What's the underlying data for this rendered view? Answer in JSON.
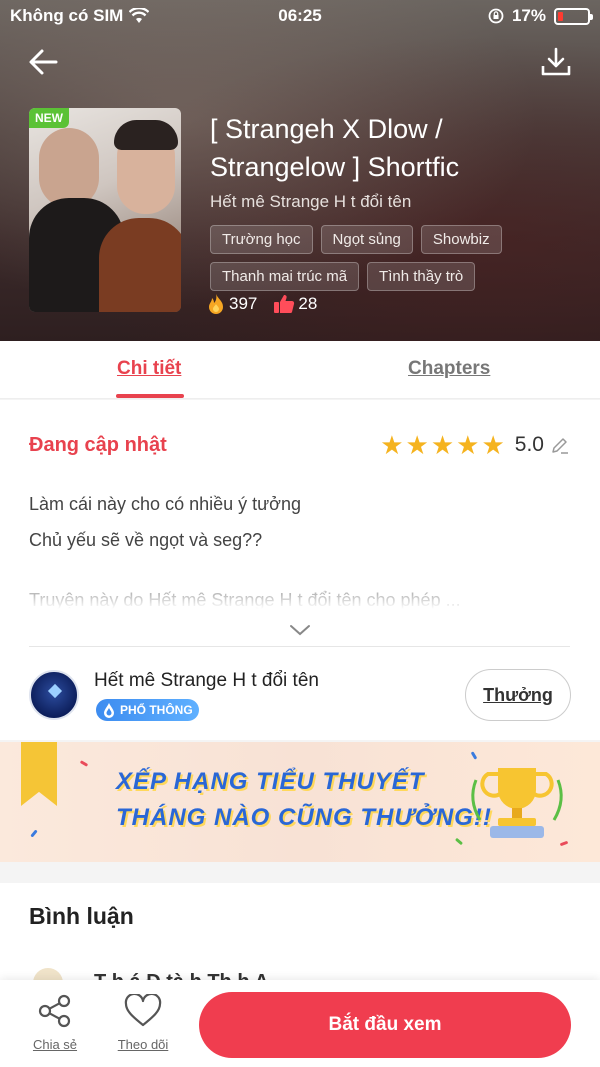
{
  "status_bar": {
    "carrier": "Không có SIM",
    "time": "06:25",
    "battery": "17%"
  },
  "book": {
    "badge": "NEW",
    "title": "[ Strangeh X Dlow / Strangelow ] Shortfic",
    "author": "Hết mê Strange H t đổi tên",
    "tags": [
      "Trường học",
      "Ngọt sủng",
      "Showbiz",
      "Thanh mai trúc mã",
      "Tình thầy trò"
    ],
    "fire_count": "397",
    "like_count": "28"
  },
  "tabs": {
    "detail": "Chi tiết",
    "chapters": "Chapters"
  },
  "detail": {
    "status": "Đang cập nhật",
    "rating": "5.0",
    "stars": 5,
    "description_lines": [
      "Làm cái này cho có nhiều ý tưởng",
      "Chủ yếu sẽ về ngọt và seg??"
    ],
    "faded_line": "Truyện này do Hết mê Strange H t đổi tên cho phép ..."
  },
  "uploader": {
    "name": "Hết mê Strange H t đổi tên",
    "rank": "PHỔ THÔNG",
    "reward_button": "Thưởng"
  },
  "banner": {
    "line1": "XẾP HẠNG TIỂU THUYẾT",
    "line2": "THÁNG NÀO CŨNG THƯỞNG!!"
  },
  "comments": {
    "title": "Bình luận",
    "peek": "T   h   á   Đ       tà   h   Th   h  A"
  },
  "bottom_bar": {
    "share": "Chia sẻ",
    "follow": "Theo dõi",
    "start": "Bắt đầu xem"
  },
  "colors": {
    "accent": "#e8424e",
    "button": "#f03d4f",
    "star": "#f5b31f"
  }
}
